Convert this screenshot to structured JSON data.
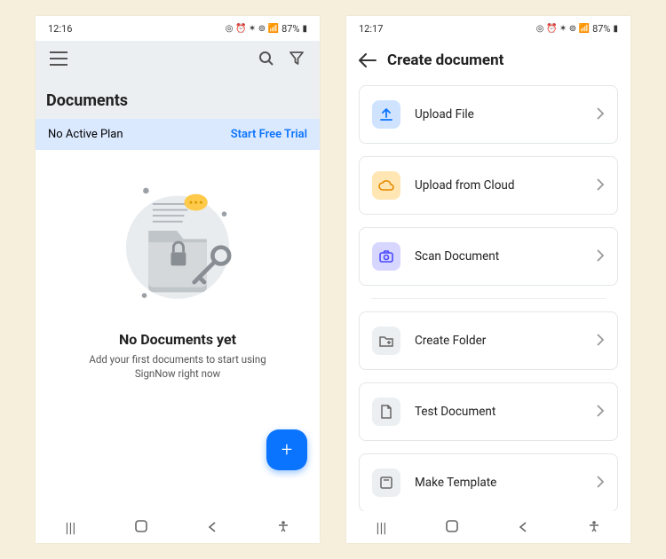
{
  "screen1": {
    "status": {
      "time": "12:16",
      "battery": "87%"
    },
    "title": "Documents",
    "banner": {
      "plan": "No Active Plan",
      "cta": "Start Free Trial"
    },
    "empty": {
      "title": "No Documents yet",
      "subtitle": "Add your first documents to start using SignNow right now"
    }
  },
  "screen2": {
    "status": {
      "time": "12:17",
      "battery": "87%"
    },
    "title": "Create document",
    "options": [
      {
        "label": "Upload File"
      },
      {
        "label": "Upload from Cloud"
      },
      {
        "label": "Scan Document"
      },
      {
        "label": "Create Folder"
      },
      {
        "label": "Test Document"
      },
      {
        "label": "Make Template"
      }
    ]
  }
}
